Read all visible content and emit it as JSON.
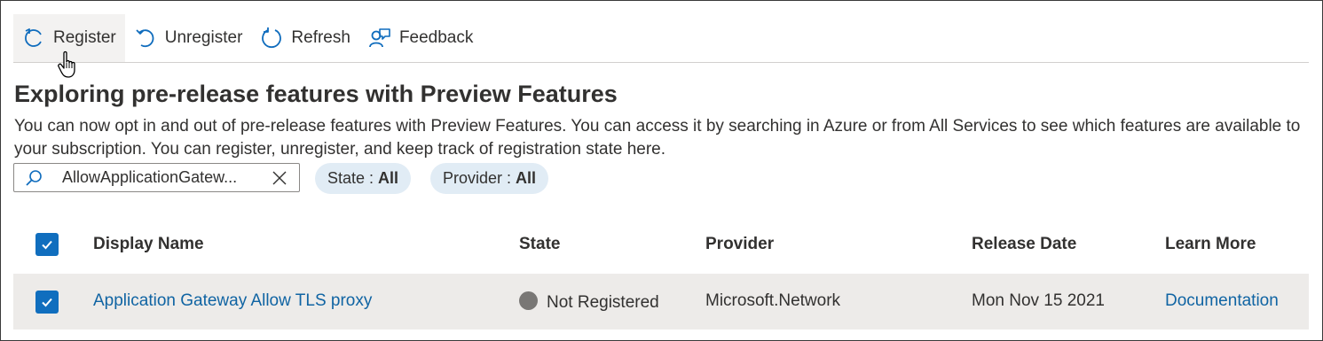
{
  "toolbar": {
    "register": "Register",
    "unregister": "Unregister",
    "refresh": "Refresh",
    "feedback": "Feedback"
  },
  "page": {
    "title": "Exploring pre-release features with Preview Features",
    "description": "You can now opt in and out of pre-release features with Preview Features. You can access it by searching in Azure or from All Services to see which features are available to your subscription. You can register, unregister, and keep track of registration state here."
  },
  "search": {
    "value": "AllowApplicationGatew..."
  },
  "filters": {
    "state_label": "State :",
    "state_value": "All",
    "provider_label": "Provider :",
    "provider_value": "All"
  },
  "table": {
    "headers": {
      "display_name": "Display Name",
      "state": "State",
      "provider": "Provider",
      "release_date": "Release Date",
      "learn_more": "Learn More"
    },
    "rows": [
      {
        "display_name": "Application Gateway Allow TLS proxy",
        "state": "Not Registered",
        "provider": "Microsoft.Network",
        "release_date": "Mon Nov 15 2021",
        "learn_more": "Documentation",
        "selected": true
      }
    ]
  },
  "colors": {
    "accent": "#106ebe",
    "link": "#1064a3",
    "pill_bg": "#e1ecf5",
    "row_selected_bg": "#edebe9",
    "status_dot": "#797775"
  },
  "icons": [
    "register-icon",
    "unregister-icon",
    "refresh-icon",
    "feedback-icon",
    "search-icon",
    "clear-icon",
    "checkmark-icon",
    "hand-cursor-icon"
  ]
}
